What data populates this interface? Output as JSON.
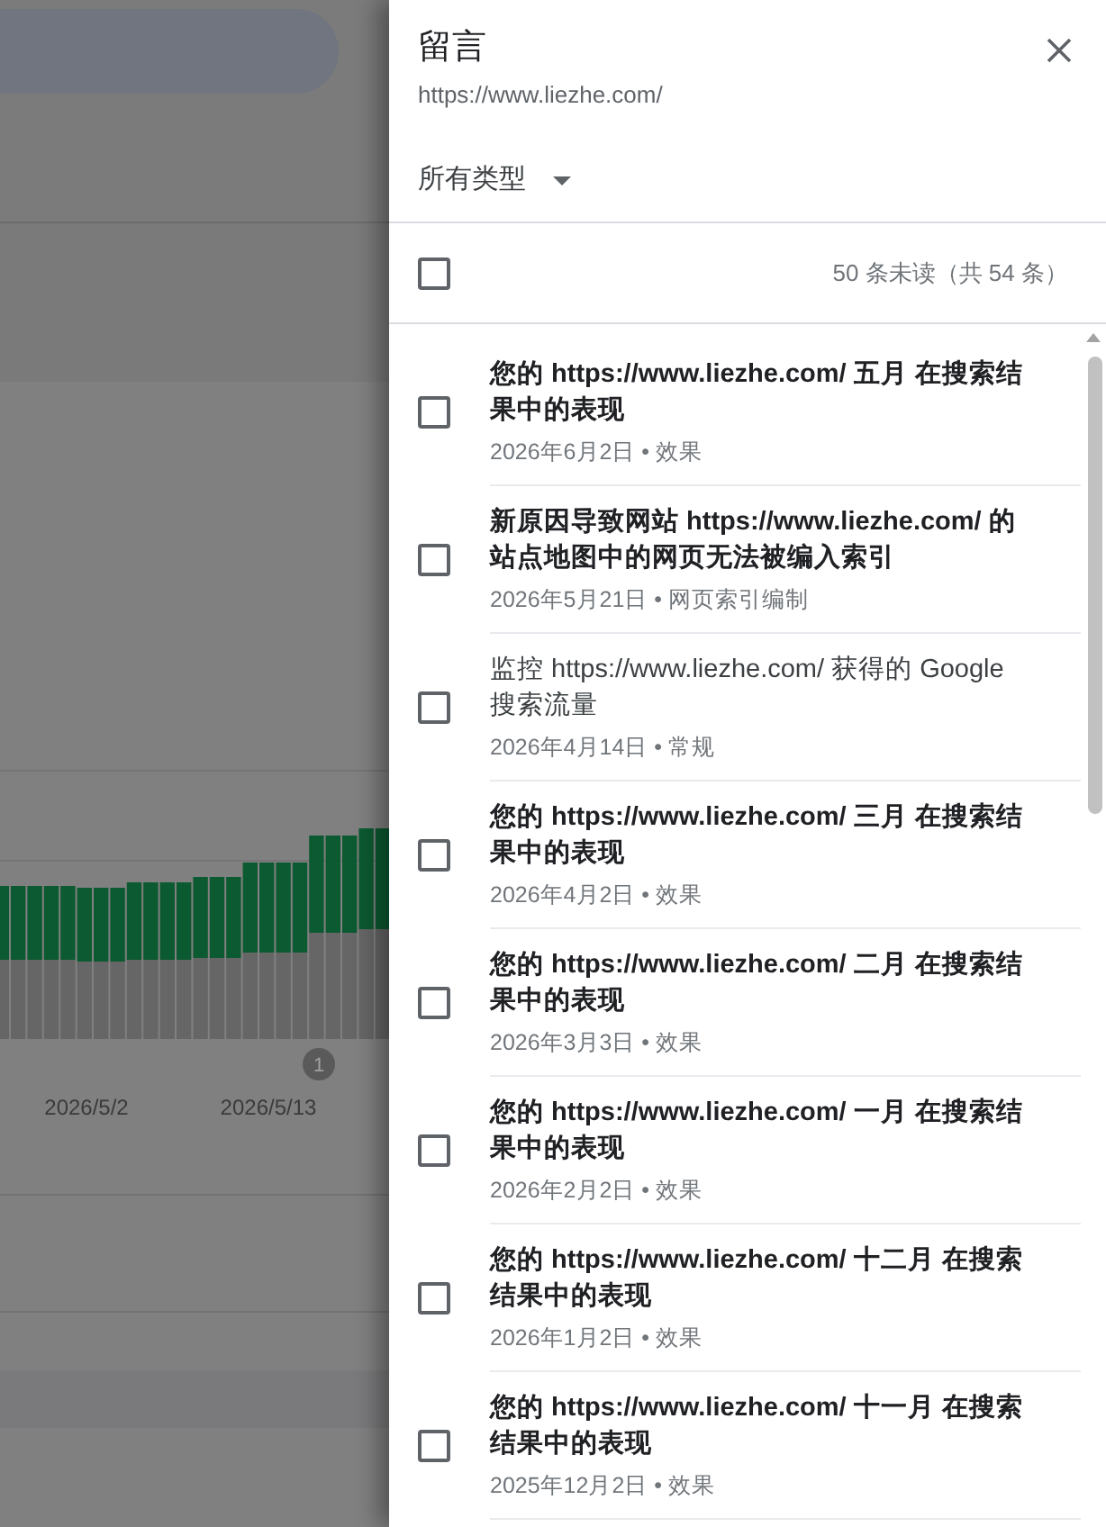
{
  "background_page": {
    "chart": {
      "x_labels": [
        "2026/5/2",
        "2026/5/13"
      ],
      "annotation": "1"
    }
  },
  "panel": {
    "title": "留言",
    "site": "https://www.liezhe.com/",
    "filter": "所有类型",
    "select_all": {
      "checked": false
    },
    "count": "50 条未读（共 54 条）"
  },
  "messages": [
    {
      "title": "您的 https://www.liezhe.com/ 五月 在搜索结果中的表现",
      "meta": "2026年6月2日 • 效果",
      "unread": true,
      "checked": false
    },
    {
      "title": "新原因导致网站 https://www.liezhe.com/ 的站点地图中的网页无法被编入索引",
      "meta": "2026年5月21日 • 网页索引编制",
      "unread": true,
      "checked": false
    },
    {
      "title": "监控 https://www.liezhe.com/ 获得的 Google 搜索流量",
      "meta": "2026年4月14日 • 常规",
      "unread": false,
      "checked": false
    },
    {
      "title": "您的 https://www.liezhe.com/ 三月 在搜索结果中的表现",
      "meta": "2026年4月2日 • 效果",
      "unread": true,
      "checked": false
    },
    {
      "title": "您的 https://www.liezhe.com/ 二月 在搜索结果中的表现",
      "meta": "2026年3月3日 • 效果",
      "unread": true,
      "checked": false
    },
    {
      "title": "您的 https://www.liezhe.com/ 一月 在搜索结果中的表现",
      "meta": "2026年2月2日 • 效果",
      "unread": true,
      "checked": false
    },
    {
      "title": "您的 https://www.liezhe.com/ 十二月 在搜索结果中的表现",
      "meta": "2026年1月2日 • 效果",
      "unread": true,
      "checked": false
    },
    {
      "title": "您的 https://www.liezhe.com/ 十一月 在搜索结果中的表现",
      "meta": "2025年12月2日 • 效果",
      "unread": true,
      "checked": false
    }
  ]
}
